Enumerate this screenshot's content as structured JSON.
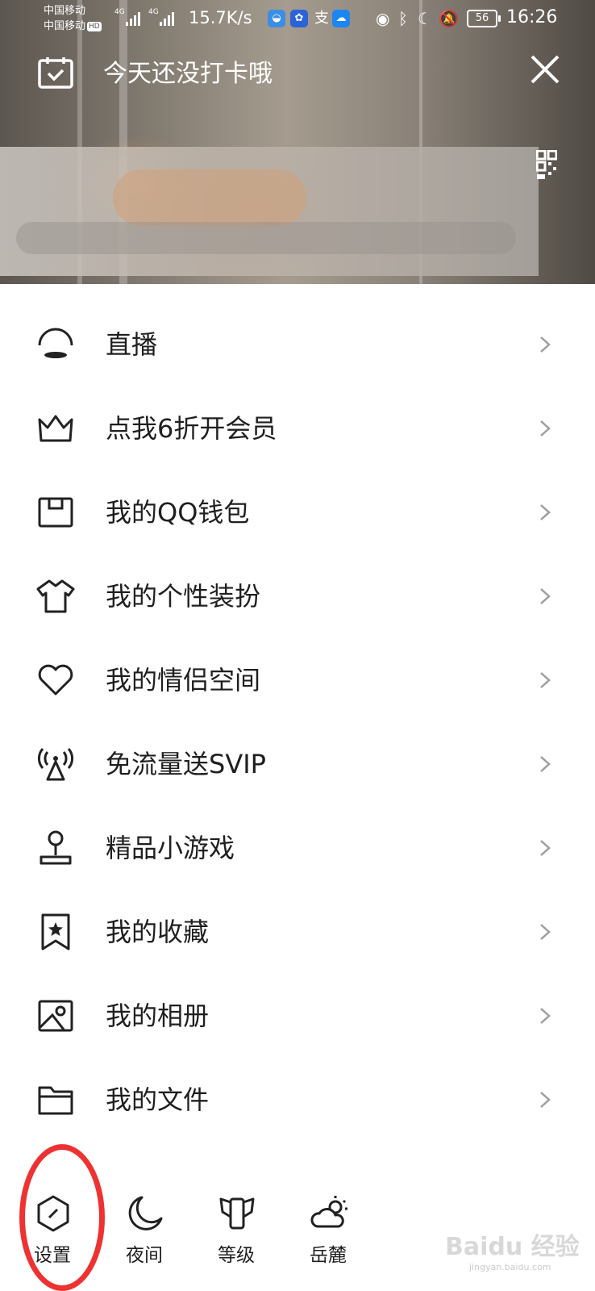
{
  "status_bar": {
    "carrier_1": "中国移动",
    "carrier_2": "中国移动",
    "hd": "HD",
    "signal_1": "4G",
    "signal_2": "4G",
    "net_speed": "15.7K/s",
    "battery": "56",
    "time": "16:26"
  },
  "header": {
    "checkin_text": "今天还没打卡哦"
  },
  "menu": {
    "items": [
      {
        "label": "直播",
        "icon": "live-icon"
      },
      {
        "label": "点我6折开会员",
        "icon": "crown-icon"
      },
      {
        "label": "我的QQ钱包",
        "icon": "wallet-icon"
      },
      {
        "label": "我的个性装扮",
        "icon": "shirt-icon"
      },
      {
        "label": "我的情侣空间",
        "icon": "heart-icon"
      },
      {
        "label": "免流量送SVIP",
        "icon": "antenna-icon"
      },
      {
        "label": "精品小游戏",
        "icon": "joystick-icon"
      },
      {
        "label": "我的收藏",
        "icon": "bookmark-star-icon"
      },
      {
        "label": "我的相册",
        "icon": "photo-album-icon"
      },
      {
        "label": "我的文件",
        "icon": "folder-icon"
      }
    ]
  },
  "bottom_bar": {
    "settings": "设置",
    "night": "夜间",
    "level": "等级",
    "weather": "岳麓"
  },
  "watermark": {
    "brand": "Baidu 经验",
    "url": "jingyan.baidu.com"
  },
  "colors": {
    "highlight_ring": "#ee3232",
    "text": "#1f1f1f",
    "chevron": "#9e9e9e"
  }
}
